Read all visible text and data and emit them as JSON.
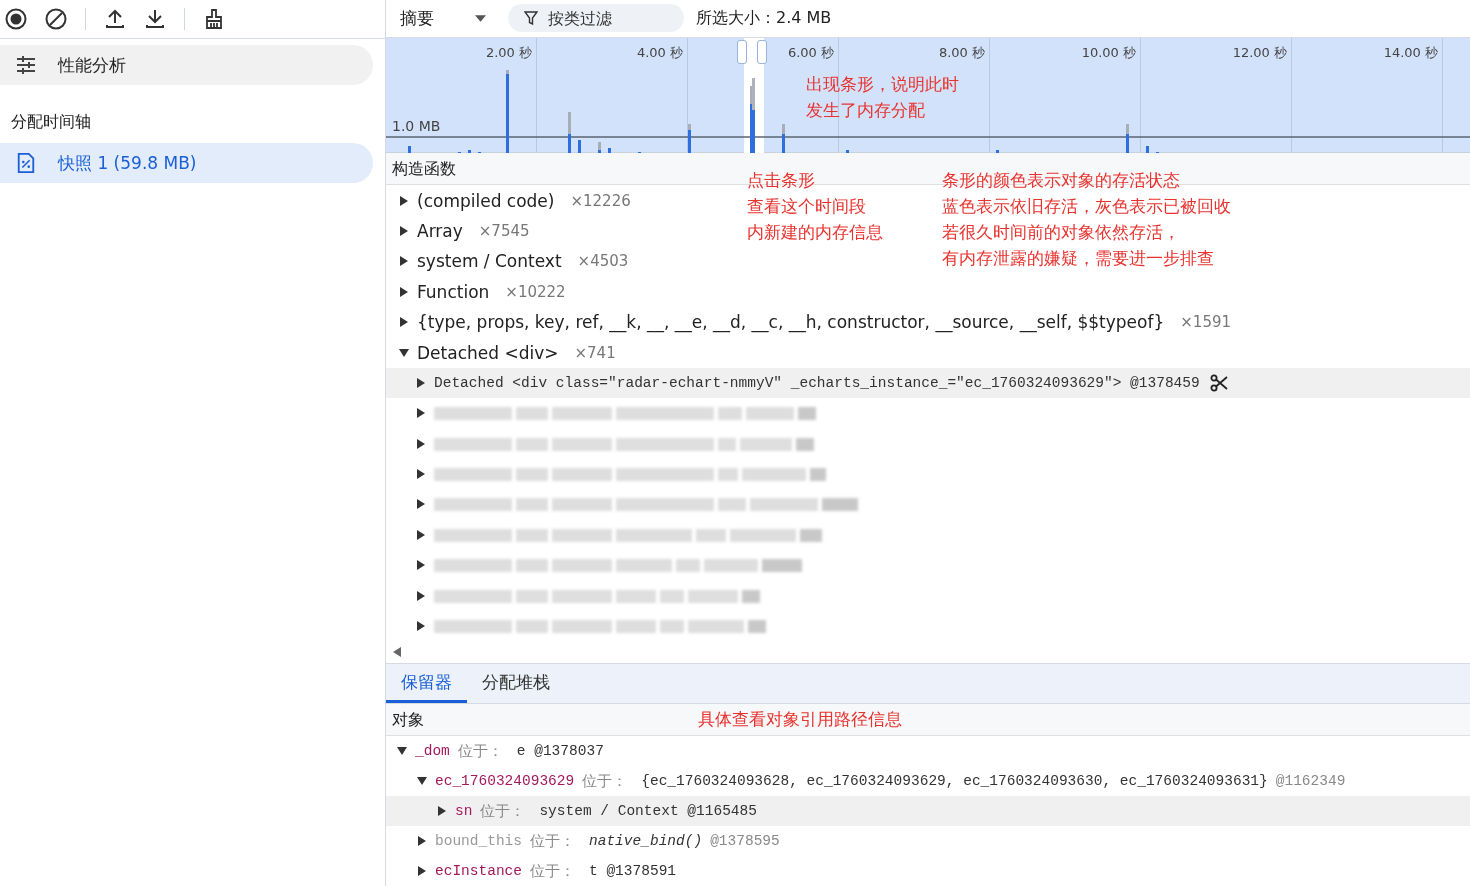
{
  "sidebar": {
    "toolbar": [
      {
        "kind": "record"
      },
      {
        "kind": "clear"
      },
      {
        "kind": "upload"
      },
      {
        "kind": "download"
      },
      {
        "kind": "collect"
      }
    ],
    "profile_type": {
      "label": "性能分析",
      "selected": false
    },
    "section": "分配时间轴",
    "snapshots": [
      {
        "label": "快照 1 (59.8 MB)",
        "selected": true
      }
    ]
  },
  "toolbar": {
    "view": "摘要",
    "filter": {
      "placeholder": "按类过滤"
    },
    "selected_size": "所选大小：2.4 MB"
  },
  "timeline": {
    "ticks": [
      "2.00 秒",
      "4.00 秒",
      "6.00 秒",
      "8.00 秒",
      "10.00 秒",
      "12.00 秒",
      "14.00 秒"
    ],
    "baseline_label": "1.0 MB",
    "annotation": [
      "出现条形，说明此时",
      "发生了内存分配"
    ]
  },
  "constructors": {
    "header": "构造函数",
    "rows": [
      {
        "name": "(compiled code)",
        "count": "×12226",
        "expanded": false
      },
      {
        "name": "Array",
        "count": "×7545",
        "expanded": false
      },
      {
        "name": "system / Context",
        "count": "×4503",
        "expanded": false
      },
      {
        "name": "Function",
        "count": "×10222",
        "expanded": false
      },
      {
        "name": "{type, props, key, ref, __k, __, __e, __d, __c, __h, constructor, __source, __self, $$typeof}",
        "count": "×1591",
        "expanded": false
      },
      {
        "name": "Detached <div>",
        "count": "×741",
        "expanded": true
      }
    ],
    "child": {
      "text": "Detached <div class=\"radar-echart-nmmyV\" _echarts_instance_=\"ec_1760324093629\"> @1378459",
      "selected": true
    },
    "redacted_rows": [
      {
        "kind": "blurred"
      },
      {
        "kind": "blurred"
      },
      {
        "kind": "blurred"
      },
      {
        "kind": "blurred"
      },
      {
        "kind": "blurred"
      },
      {
        "kind": "blurred"
      },
      {
        "kind": "blurred"
      },
      {
        "kind": "blurred"
      }
    ],
    "annotations": [
      [
        "点击条形",
        "查看这个时间段",
        "内新建的内存信息"
      ],
      [
        "条形的颜色表示对象的存活状态",
        "蓝色表示依旧存活，灰色表示已被回收",
        "若很久时间前的对象依然存活，",
        "有内存泄露的嫌疑，需要进一步排查"
      ]
    ]
  },
  "bottom_tabs": [
    {
      "label": "保留器",
      "selected": true
    },
    {
      "label": "分配堆栈",
      "selected": false
    }
  ],
  "retainers": {
    "header": "对象",
    "annotation": "具体查看对象引用路径信息",
    "rows": [
      {
        "name": "_dom",
        "at": "位于：",
        "value": "e @1378037",
        "expanded": true,
        "internal": false,
        "selected": false,
        "children": [
          {
            "name": "ec_1760324093629",
            "at": "位于：",
            "value": "{ec_1760324093628, ec_1760324093629, ec_1760324093630, ec_1760324093631}",
            "id": "@1162349",
            "expanded": true,
            "internal": false,
            "selected": false,
            "children": [
              {
                "name": "sn",
                "at": "位于：",
                "value": "system / Context @1165485",
                "expanded": false,
                "internal": false,
                "selected": true
              }
            ]
          },
          {
            "name": "bound_this",
            "at": "位于：",
            "value": "native_bind()",
            "id": "@1378595",
            "italic": true,
            "expanded": false,
            "internal": true,
            "selected": false
          },
          {
            "name": "ecInstance",
            "at": "位于：",
            "value": "t @1378591",
            "expanded": false,
            "internal": false,
            "selected": false
          }
        ]
      }
    ]
  }
}
